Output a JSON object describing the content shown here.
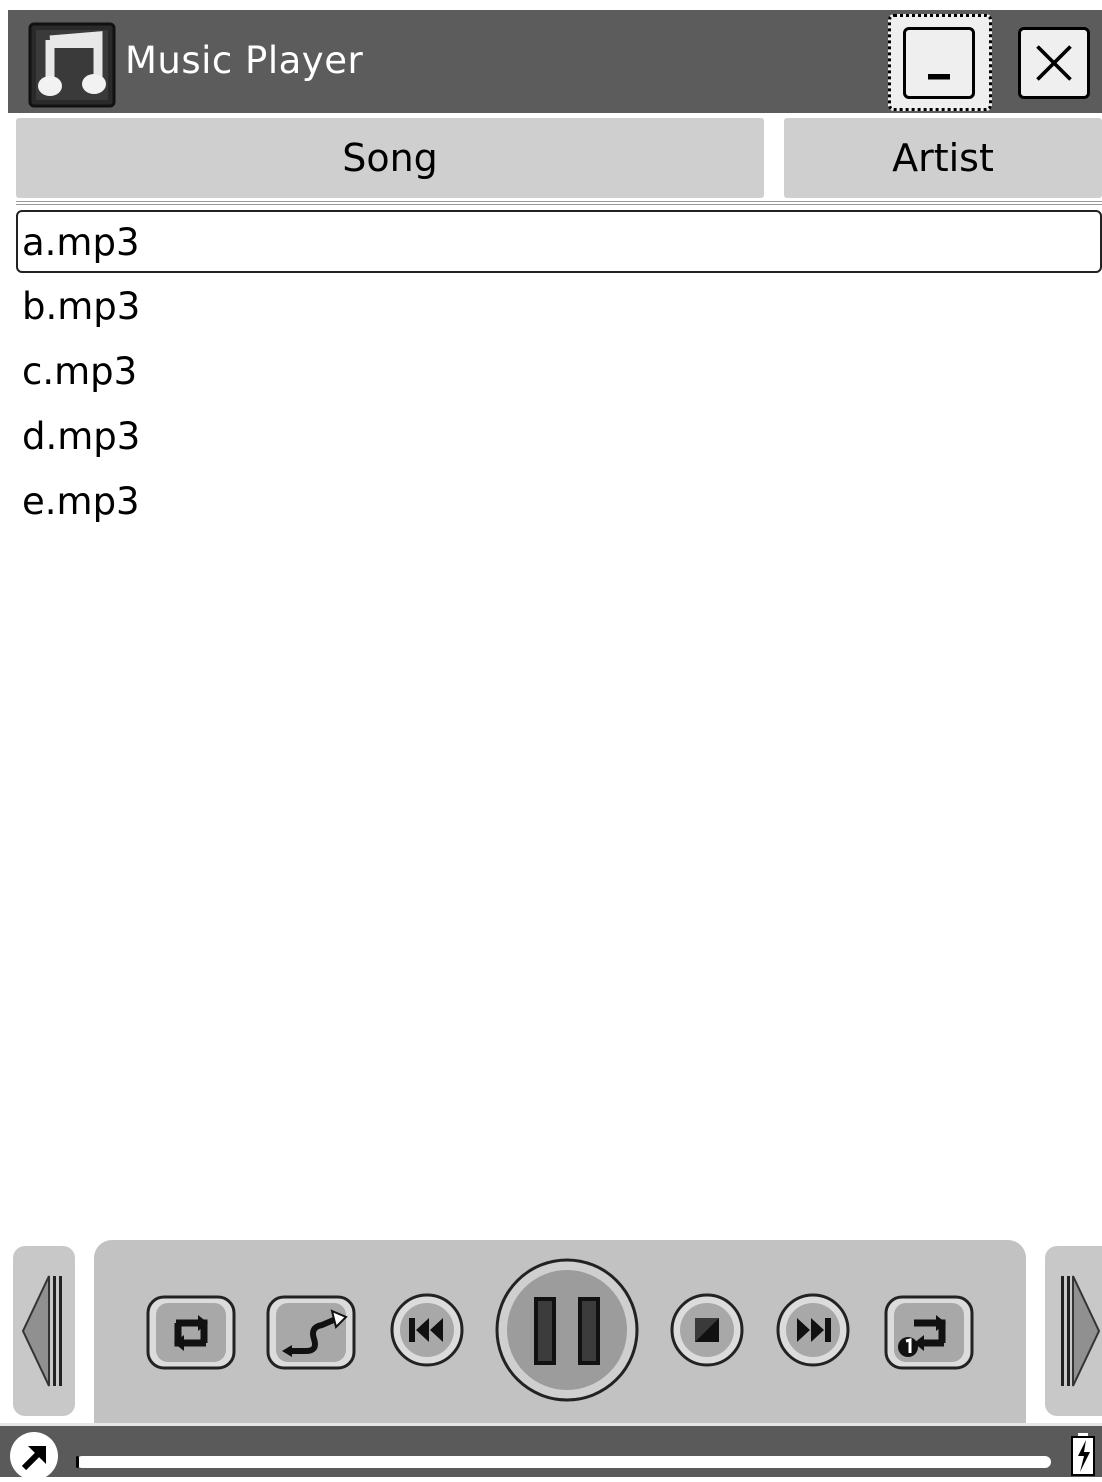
{
  "window": {
    "title": "Music Player",
    "icons": {
      "app": "music-note-icon",
      "minimize": "minimize-icon",
      "close": "close-icon"
    }
  },
  "columns": [
    {
      "label": "Song"
    },
    {
      "label": "Artist"
    }
  ],
  "songs": [
    {
      "name": "a.mp3",
      "selected": true
    },
    {
      "name": "b.mp3",
      "selected": false
    },
    {
      "name": "c.mp3",
      "selected": false
    },
    {
      "name": "d.mp3",
      "selected": false
    },
    {
      "name": "e.mp3",
      "selected": false
    }
  ],
  "player": {
    "controls": [
      "repeat-all-icon",
      "shuffle-icon",
      "previous-track-icon",
      "pause-icon",
      "stop-icon",
      "next-track-icon",
      "repeat-one-icon"
    ],
    "nav": [
      "scroll-left-icon",
      "scroll-right-icon"
    ]
  },
  "status": {
    "icons": [
      "launcher-arrow-icon",
      "battery-charging-icon"
    ],
    "progress_fraction": 0.0
  },
  "colors": {
    "titlebar": "#5c5c5c",
    "header": "#cfcfcf",
    "panel": "#c2c2c2",
    "statusbar": "#5a5a5a"
  }
}
